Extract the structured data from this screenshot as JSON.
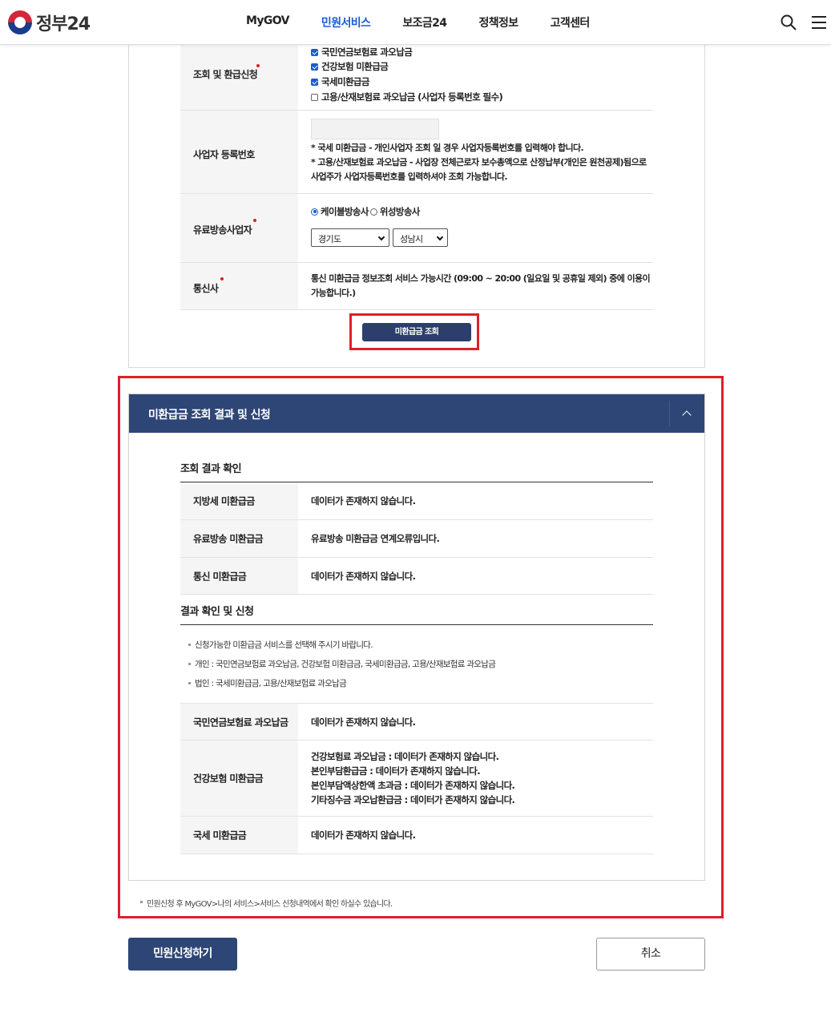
{
  "header": {
    "logo_text": "정부24",
    "nav": [
      "MyGOV",
      "민원서비스",
      "보조금24",
      "정책정보",
      "고객센터"
    ],
    "active_nav": "민원서비스",
    "search_icon": "search-icon",
    "menu_icon": "hamburger-menu-icon"
  },
  "form": {
    "refund_label": "조회 및 환급신청",
    "refund_options": [
      {
        "label": "국민연금보험료 과오납금",
        "checked": true
      },
      {
        "label": "건강보험 미환급금",
        "checked": true
      },
      {
        "label": "국세미환급금",
        "checked": true
      },
      {
        "label": "고용/산재보험료 과오납금 (사업자 등록번호 필수)",
        "checked": false
      }
    ],
    "biz_label": "사업자 등록번호",
    "biz_value": "",
    "biz_note1": "* 국세 미환급금 - 개인사업자 조회 일 경우 사업자등록번호를 입력해야 합니다.",
    "biz_note2": "* 고용/산재보험료 과오납금 - 사업장 전체근로자 보수총액으로 산정납부(개인은 원천공제)됨으로 사업주가 사업자등록번호를 입력하셔야 조회 가능합니다.",
    "broadcast_label": "유료방송사업자",
    "broadcast_radio1": "케이블방송사",
    "broadcast_radio2": "위성방송사",
    "region_select": "경기도",
    "city_select": "성남시",
    "telecom_label": "통신사",
    "telecom_note": "통신 미환급금 정보조회 서비스 가능시간 (09:00 ~ 20:00 (일요일 및 공휴일 제외) 중에 이용이 가능합니다.)",
    "query_button": "미환급금 조회"
  },
  "result": {
    "section_title": "미환급금 조회 결과 및 신청",
    "check_title": "조회 결과 확인",
    "check_rows": [
      {
        "label": "지방세 미환급금",
        "value": "데이터가 존재하지 않습니다."
      },
      {
        "label": "유료방송 미환급금",
        "value": "유료방송 미환급금 연계오류입니다."
      },
      {
        "label": "통신 미환급금",
        "value": "데이터가 존재하지 않습니다."
      }
    ],
    "apply_title": "결과 확인 및 신청",
    "bullets": [
      "신청가능한 미환급금 서비스를 선택해 주시기 바랍니다.",
      "개인 : 국민연금보험료 과오납금, 건강보험 미환급금, 국세미환급금, 고용/산재보험료 과오납금",
      "법인 : 국세미환급금, 고용/산재보험료 과오납금"
    ],
    "apply_rows": {
      "pension_label": "국민연금보험료 과오납금",
      "pension_value": "데이터가 존재하지 않습니다.",
      "health_label": "건강보험 미환급금",
      "health_lines": [
        "건강보험료 과오납금 : 데이터가 존재하지 않습니다.",
        "본인부담환급금 : 데이터가 존재하지 않습니다.",
        "본인부담액상한액 초과금 : 데이터가 존재하지 않습니다.",
        "기타징수금 과오납환급금 : 데이터가 존재하지 않습니다."
      ],
      "tax_label": "국세 미환급금",
      "tax_value": "데이터가 존재하지 않습니다."
    },
    "footnote": "민원신청 후 MyGOV>나의 서비스>서비스 신청내역에서 확인 하실수 있습니다."
  },
  "actions": {
    "apply_button": "민원신청하기",
    "cancel_button": "취소"
  },
  "colors": {
    "accent_navy": "#2e4676",
    "active_nav": "#1a5bd1",
    "highlight_red": "#e01e2a"
  }
}
